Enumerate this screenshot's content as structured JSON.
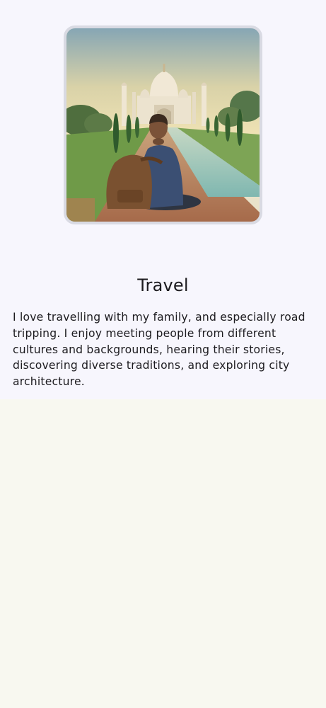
{
  "profile": {
    "image": {
      "icon": "travel-photo-taj-mahal",
      "alt": ""
    },
    "title": "Travel",
    "description": "I love travelling with my family, and especially road tripping. I enjoy meeting people from different cultures and backgrounds, hearing their stories, discovering diverse traditions, and exploring city architecture."
  },
  "colors": {
    "card_background": "#f7f6fd",
    "page_background": "#f8f8f0",
    "image_border": "#d9dae3",
    "text": "#1c1b1f"
  }
}
